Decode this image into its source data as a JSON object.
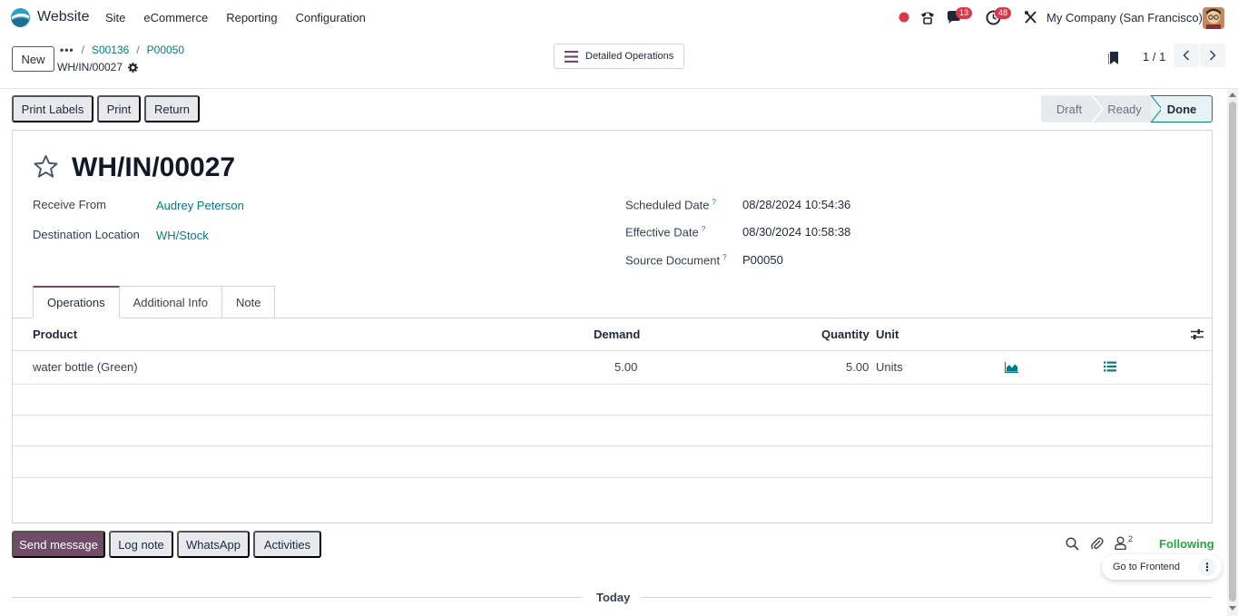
{
  "navbar": {
    "app_name": "Website",
    "menu": [
      "Site",
      "eCommerce",
      "Reporting",
      "Configuration"
    ],
    "messages_count": "13",
    "activities_count": "48",
    "company": "My Company (San Francisco)"
  },
  "control_panel": {
    "new_label": "New",
    "breadcrumb": [
      "S00136",
      "P00050"
    ],
    "record_name": "WH/IN/00027",
    "detailed_ops_label": "Detailed Operations",
    "pager": "1 / 1"
  },
  "actions": {
    "print_labels": "Print Labels",
    "print": "Print",
    "return": "Return"
  },
  "statusbar": [
    "Draft",
    "Ready",
    "Done"
  ],
  "form": {
    "title": "WH/IN/00027",
    "receive_from_label": "Receive From",
    "receive_from": "Audrey Peterson",
    "destination_label": "Destination Location",
    "destination": "WH/Stock",
    "scheduled_label": "Scheduled Date",
    "scheduled": "08/28/2024 10:54:36",
    "effective_label": "Effective Date",
    "effective": "08/30/2024 10:58:38",
    "source_label": "Source Document",
    "source": "P00050",
    "help_mark": "?"
  },
  "tabs": [
    "Operations",
    "Additional Info",
    "Note"
  ],
  "table": {
    "headers": {
      "product": "Product",
      "demand": "Demand",
      "quantity": "Quantity",
      "unit": "Unit"
    },
    "rows": [
      {
        "product": "water bottle (Green)",
        "demand": "5.00",
        "quantity": "5.00",
        "unit": "Units"
      }
    ]
  },
  "chatter": {
    "send_message": "Send message",
    "log_note": "Log note",
    "whatsapp": "WhatsApp",
    "activities": "Activities",
    "followers_count": "2",
    "following": "Following",
    "go_to_frontend": "Go to Frontend",
    "today": "Today"
  },
  "colors": {
    "brand": "#714b67",
    "link": "#017e84",
    "following": "#28a745",
    "badge": "#d9394a"
  }
}
